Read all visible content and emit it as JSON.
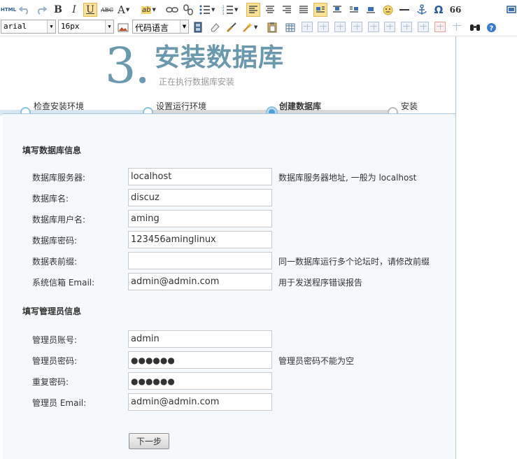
{
  "toolbar": {
    "html_label": "HTML",
    "bold_label": "B",
    "italic_label": "I",
    "underline_label": "U",
    "strike_label": "ABC",
    "fontcolor_label": "A",
    "highlight_label": "ab",
    "omega_label": "Ω",
    "quote_label": "66",
    "font_family": "arial",
    "font_size": "16px",
    "code_language": "代码语言"
  },
  "header": {
    "step_number": "3.",
    "title": "安装数据库",
    "subtitle": "正在执行数据库安装"
  },
  "steps": [
    {
      "label": "检查安装环境"
    },
    {
      "label": "设置运行环境"
    },
    {
      "label": "创建数据库"
    },
    {
      "label": "安装"
    }
  ],
  "form": {
    "db_section_title": "填写数据库信息",
    "admin_section_title": "填写管理员信息",
    "db_fields": [
      {
        "label": "数据库服务器:",
        "value": "localhost",
        "note": "数据库服务器地址, 一般为 localhost"
      },
      {
        "label": "数据库名:",
        "value": "discuz",
        "note": ""
      },
      {
        "label": "数据库用户名:",
        "value": "aming",
        "note": ""
      },
      {
        "label": "数据库密码:",
        "value": "123456aminglinux",
        "note": ""
      },
      {
        "label": "数据表前缀:",
        "value": "",
        "note": "同一数据库运行多个论坛时，请修改前缀"
      },
      {
        "label": "系统信箱 Email:",
        "value": "admin@admin.com",
        "note": "用于发送程序错误报告"
      }
    ],
    "admin_fields": [
      {
        "label": "管理员账号:",
        "value": "admin",
        "note": ""
      },
      {
        "label": "管理员密码:",
        "value": "●●●●●●",
        "note": "管理员密码不能为空"
      },
      {
        "label": "重复密码:",
        "value": "●●●●●●",
        "note": ""
      },
      {
        "label": "管理员 Email:",
        "value": "admin@admin.com",
        "note": ""
      }
    ],
    "next_button": "下一步"
  },
  "colors": {
    "accent": "#6a99ae",
    "step_blue": "#4aa0d8",
    "form_bg": "#f6f9fc"
  }
}
